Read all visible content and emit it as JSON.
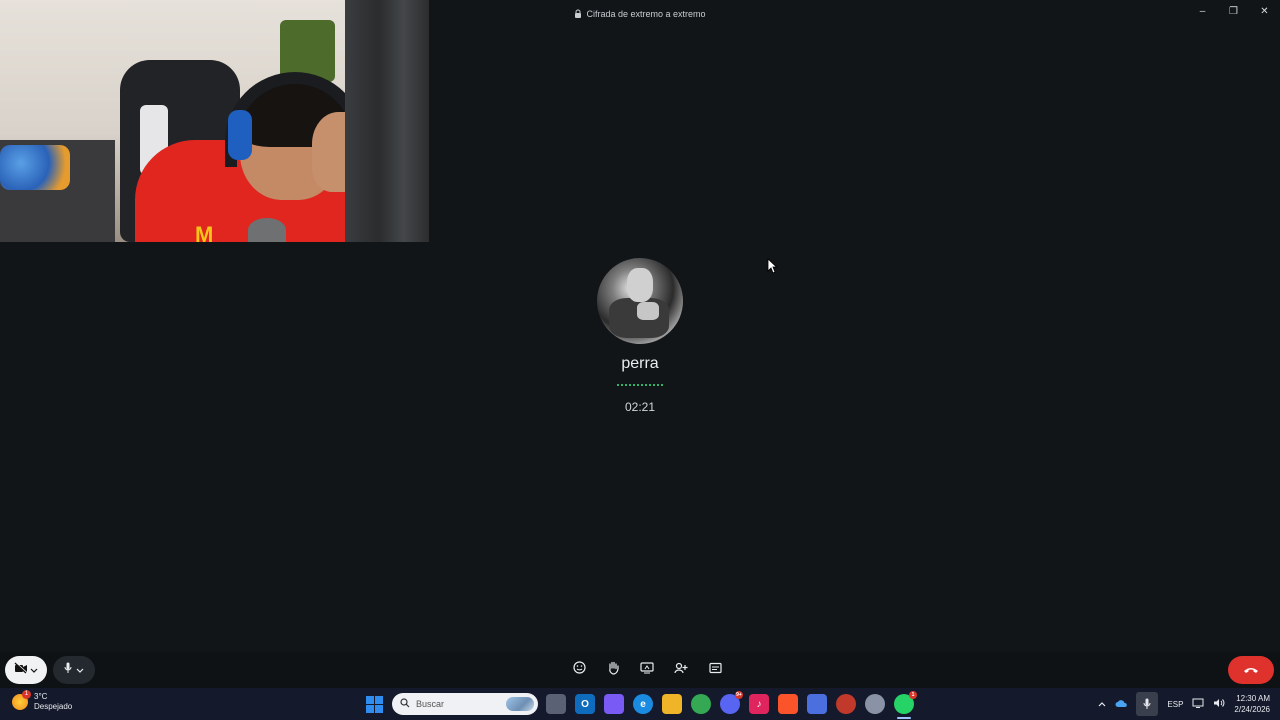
{
  "window": {
    "title": "Cifrada de extremo a extremo",
    "title_icon": "lock-icon",
    "controls": [
      "minimize-icon",
      "maximize-icon",
      "close-icon"
    ]
  },
  "call": {
    "contact_name": "perra",
    "timer": "02:21",
    "accent_color": "#2fb36a"
  },
  "controls": {
    "camera": {
      "icon": "camera-off-icon",
      "state": "off"
    },
    "mic": {
      "icon": "microphone-icon"
    },
    "middle": [
      "emoji-reaction-icon",
      "raise-hand-icon",
      "screen-share-icon",
      "add-participant-icon",
      "captions-icon"
    ],
    "end_call": {
      "icon": "end-call-icon",
      "color": "#e0322d"
    }
  },
  "taskbar": {
    "weather": {
      "temp": "3°C",
      "condition": "Despejado",
      "alert_count": "1"
    },
    "search_placeholder": "Buscar",
    "apps": [
      {
        "name": "task-view",
        "color": "#5a6175",
        "label": ""
      },
      {
        "name": "outlook",
        "color": "#0f6cbd",
        "label": "O"
      },
      {
        "name": "copilot",
        "color": "#7a5af5",
        "label": ""
      },
      {
        "name": "edge",
        "color": "#1a8be0",
        "label": "e"
      },
      {
        "name": "file-explorer",
        "color": "#f0b429",
        "label": ""
      },
      {
        "name": "chrome",
        "color": "#34a853",
        "label": ""
      },
      {
        "name": "discord",
        "color": "#5865f2",
        "label": "",
        "badge": "9+"
      },
      {
        "name": "tiktok",
        "color": "#e0245e",
        "label": "♪"
      },
      {
        "name": "brave",
        "color": "#fb542b",
        "label": ""
      },
      {
        "name": "app-blue",
        "color": "#4c6fe0",
        "label": ""
      },
      {
        "name": "app-red",
        "color": "#c0392b",
        "label": ""
      },
      {
        "name": "settings",
        "color": "#8a93a5",
        "label": ""
      },
      {
        "name": "whatsapp",
        "color": "#25d366",
        "label": "",
        "badge": "1",
        "active": true
      }
    ],
    "tray": {
      "language": "ESP",
      "time": "12:30 AM",
      "date": "2/24/2026"
    }
  }
}
